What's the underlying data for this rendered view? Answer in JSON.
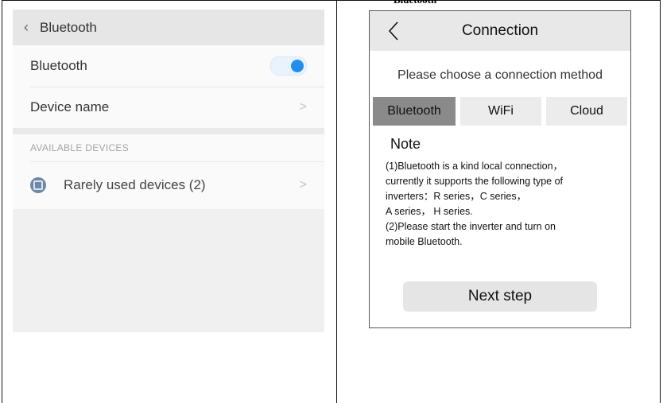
{
  "document": {
    "cut_caption": "Bluetooth"
  },
  "left_screen": {
    "header": {
      "back_icon": "chevron-left-icon",
      "title": "Bluetooth"
    },
    "rows": [
      {
        "label": "Bluetooth",
        "control": "toggle",
        "toggle_on": true,
        "accent": "#1e8ff0"
      },
      {
        "label": "Device name",
        "control": "chevron"
      }
    ],
    "section_label": "AVAILABLE DEVICES",
    "devices": [
      {
        "label": "Rarely used devices (2)",
        "icon": "device-icon"
      }
    ],
    "chevron_glyph": ">"
  },
  "right_screen": {
    "header": {
      "title": "Connection",
      "back_icon": "chevron-left-icon"
    },
    "subtitle": "Please choose a connection method",
    "tabs": [
      {
        "label": "Bluetooth",
        "active": true
      },
      {
        "label": "WiFi",
        "active": false
      },
      {
        "label": "Cloud",
        "active": false
      }
    ],
    "note_title": "Note",
    "note_text": "(1)Bluetooth is a kind local connection，\ncurrently it supports the following type of\ninverters：R series，C series，\nA series， H series.\n(2)Please start the inverter and turn on\nmobile Bluetooth.",
    "next_button": "Next step"
  }
}
